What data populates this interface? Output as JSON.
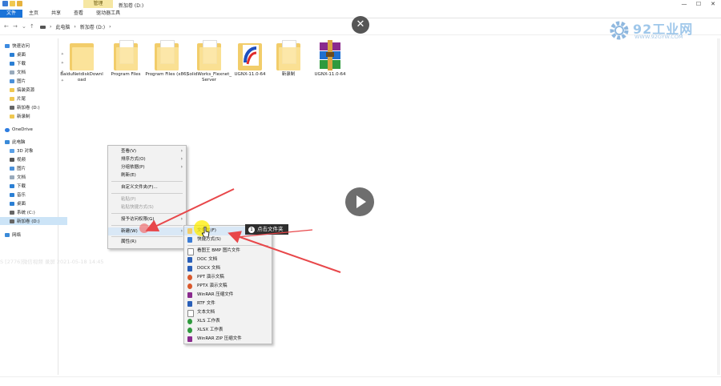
{
  "window": {
    "title": "新加卷 (D:)",
    "manage_tab": "管理"
  },
  "ribbon": {
    "tabs": [
      "文件",
      "主页",
      "共享",
      "查看",
      "驱动器工具"
    ]
  },
  "breadcrumb": [
    "此电脑",
    "新加卷 (D:)"
  ],
  "watermark": {
    "brand": "92工业网",
    "url": "WWW.92GYW.COM"
  },
  "sidebar": {
    "items": [
      {
        "label": "快速访问"
      },
      {
        "label": "桌面"
      },
      {
        "label": "下载"
      },
      {
        "label": "文档"
      },
      {
        "label": "图片"
      },
      {
        "label": "搞装资源"
      },
      {
        "label": "片尾"
      },
      {
        "label": "新加卷 (D:)"
      },
      {
        "label": "新录制"
      },
      {
        "label": "OneDrive"
      },
      {
        "label": "此电脑"
      },
      {
        "label": "3D 对象"
      },
      {
        "label": "视频"
      },
      {
        "label": "图片"
      },
      {
        "label": "文档"
      },
      {
        "label": "下载"
      },
      {
        "label": "音乐"
      },
      {
        "label": "桌面"
      },
      {
        "label": "系统 (C:)"
      },
      {
        "label": "新加卷 (D:)"
      },
      {
        "label": "网络"
      }
    ]
  },
  "files": [
    {
      "name": "BaiduNetdiskDownload"
    },
    {
      "name": "Program Files"
    },
    {
      "name": "Program Files (x86)"
    },
    {
      "name": "SolidWorks_Flexnet_Server"
    },
    {
      "name": "UGNX-11.0-64"
    },
    {
      "name": "新录制"
    },
    {
      "name": "UGNX-11.0-64"
    }
  ],
  "faded_overlay_text": "TS [2776]微信视频 录屏 2021-05-18 14:45",
  "context_menu": {
    "items": [
      {
        "label": "查看(V)"
      },
      {
        "label": "排序方式(O)"
      },
      {
        "label": "分组依据(P)"
      },
      {
        "label": "刷新(E)"
      },
      {
        "label": "自定义文件夹(F)..."
      },
      {
        "label": "粘贴(P)"
      },
      {
        "label": "粘贴快捷方式(S)"
      },
      {
        "label": "授予访问权限(G)"
      },
      {
        "label": "新建(W)"
      },
      {
        "label": "属性(R)"
      }
    ]
  },
  "new_submenu": {
    "items": [
      {
        "label": "文件夹(F)"
      },
      {
        "label": "快捷方式(S)"
      },
      {
        "label": "看图王 BMP 图片文件"
      },
      {
        "label": "DOC 文档"
      },
      {
        "label": "DOCX 文档"
      },
      {
        "label": "PPT 演示文稿"
      },
      {
        "label": "PPTX 演示文稿"
      },
      {
        "label": "WinRAR 压缩文件"
      },
      {
        "label": "RTF 文件"
      },
      {
        "label": "文本文档"
      },
      {
        "label": "XLS 工作表"
      },
      {
        "label": "XLSX 工作表"
      },
      {
        "label": "WinRAR ZIP 压缩文件"
      }
    ]
  },
  "tooltip": {
    "number": "1",
    "text": "点击文件夹"
  },
  "icons": {
    "close": "close-icon",
    "play": "play-icon",
    "folder": "folder-icon",
    "winrar": "winrar-icon",
    "arrow": "arrow-icon"
  },
  "colors": {
    "accent": "#1a73d8",
    "annotation": "#e8474a",
    "highlight_cursor": "#ffee00",
    "folder": "#f2cd6a"
  }
}
